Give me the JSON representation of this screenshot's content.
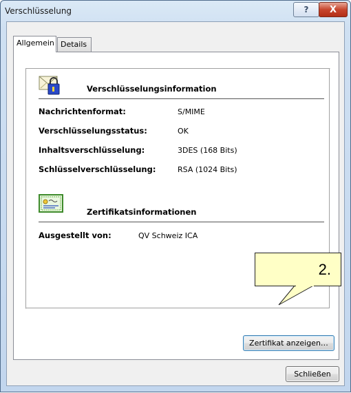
{
  "window": {
    "title": "Verschlüsselung",
    "help_label": "?",
    "close_label": "X"
  },
  "tabs": [
    {
      "label": "Allgemein",
      "active": true
    },
    {
      "label": "Details",
      "active": false
    }
  ],
  "encryption": {
    "section_title": "Verschlüsselungsinformation",
    "icon": "encrypted-envelope-icon",
    "rows": [
      {
        "label": "Nachrichtenformat:",
        "value": "S/MIME"
      },
      {
        "label": "Verschlüsselungsstatus:",
        "value": "OK"
      },
      {
        "label": "Inhaltsverschlüsselung:",
        "value": "3DES (168 Bits)"
      },
      {
        "label": "Schlüsselverschlüsselung:",
        "value": "RSA (1024 Bits)"
      }
    ]
  },
  "certificate": {
    "section_title": "Zertifikatsinformationen",
    "icon": "certificate-icon",
    "issued_by_label": "Ausgestellt von:",
    "issued_by_value": "QV Schweiz ICA"
  },
  "buttons": {
    "view_certificate": "Zertifikat anzeigen…",
    "close": "Schließen"
  },
  "annotation": {
    "label": "2."
  },
  "colors": {
    "callout_fill": "#ffffc6",
    "close_button": "#c7452d",
    "focus_border": "#3c7fb1"
  }
}
